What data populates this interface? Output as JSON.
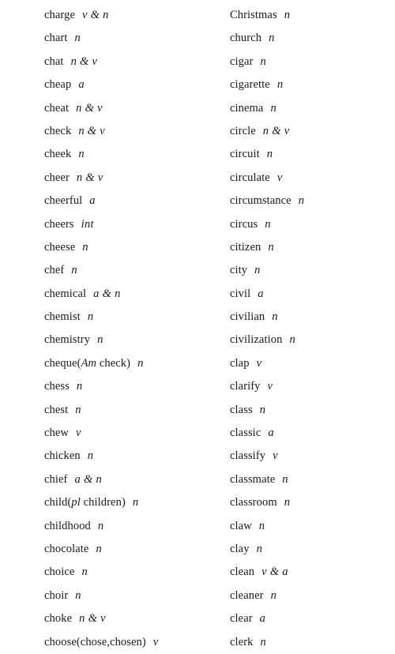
{
  "document": {
    "type": "vocabulary-word-list",
    "columns": [
      {
        "name": "left-column",
        "entries": [
          {
            "headword": "charge",
            "pos": "v & n"
          },
          {
            "headword": "chart",
            "pos": "n"
          },
          {
            "headword": "chat",
            "pos": "n & v"
          },
          {
            "headword": "cheap",
            "pos": "a"
          },
          {
            "headword": "cheat",
            "pos": "n & v"
          },
          {
            "headword": "check",
            "pos": "n & v"
          },
          {
            "headword": "cheek",
            "pos": "n"
          },
          {
            "headword": "cheer",
            "pos": "n & v"
          },
          {
            "headword": "cheerful",
            "pos": "a"
          },
          {
            "headword": "cheers",
            "pos": "int"
          },
          {
            "headword": "cheese",
            "pos": "n"
          },
          {
            "headword": "chef",
            "pos": "n"
          },
          {
            "headword": "chemical",
            "pos": "a & n"
          },
          {
            "headword": "chemist",
            "pos": "n"
          },
          {
            "headword": "chemistry",
            "pos": "n"
          },
          {
            "headword": "cheque(",
            "headword_italic": "Am",
            "headword_tail": " check)",
            "pos": "n"
          },
          {
            "headword": "chess",
            "pos": "n"
          },
          {
            "headword": "chest",
            "pos": "n"
          },
          {
            "headword": "chew",
            "pos": "v"
          },
          {
            "headword": "chicken",
            "pos": "n"
          },
          {
            "headword": "chief",
            "pos": "a & n"
          },
          {
            "headword": "child(",
            "headword_italic": "pl",
            "headword_tail": " children)",
            "pos": "n"
          },
          {
            "headword": "childhood",
            "pos": "n"
          },
          {
            "headword": "chocolate",
            "pos": "n"
          },
          {
            "headword": "choice",
            "pos": "n"
          },
          {
            "headword": "choir",
            "pos": "n"
          },
          {
            "headword": "choke",
            "pos": "n & v"
          },
          {
            "headword": "choose(chose,chosen)",
            "pos": "v"
          }
        ]
      },
      {
        "name": "right-column",
        "entries": [
          {
            "headword": "Christmas",
            "pos": "n"
          },
          {
            "headword": "church",
            "pos": "n"
          },
          {
            "headword": "cigar",
            "pos": "n"
          },
          {
            "headword": "cigarette",
            "pos": "n"
          },
          {
            "headword": "cinema",
            "pos": "n"
          },
          {
            "headword": "circle",
            "pos": "n & v"
          },
          {
            "headword": "circuit",
            "pos": "n"
          },
          {
            "headword": "circulate",
            "pos": "v"
          },
          {
            "headword": "circumstance",
            "pos": "n"
          },
          {
            "headword": "circus",
            "pos": "n"
          },
          {
            "headword": "citizen",
            "pos": "n"
          },
          {
            "headword": "city",
            "pos": "n"
          },
          {
            "headword": "civil",
            "pos": "a"
          },
          {
            "headword": "civilian",
            "pos": "n"
          },
          {
            "headword": "civilization",
            "pos": "n"
          },
          {
            "headword": "clap",
            "pos": "v"
          },
          {
            "headword": "clarify",
            "pos": "v"
          },
          {
            "headword": "class",
            "pos": "n"
          },
          {
            "headword": "classic",
            "pos": "a"
          },
          {
            "headword": "classify",
            "pos": "v"
          },
          {
            "headword": "classmate",
            "pos": "n"
          },
          {
            "headword": "classroom",
            "pos": "n"
          },
          {
            "headword": "claw",
            "pos": "n"
          },
          {
            "headword": "clay",
            "pos": "n"
          },
          {
            "headword": "clean",
            "pos": "v & a"
          },
          {
            "headword": "cleaner",
            "pos": "n"
          },
          {
            "headword": "clear",
            "pos": "a"
          },
          {
            "headword": "clerk",
            "pos": "n"
          }
        ]
      }
    ]
  }
}
